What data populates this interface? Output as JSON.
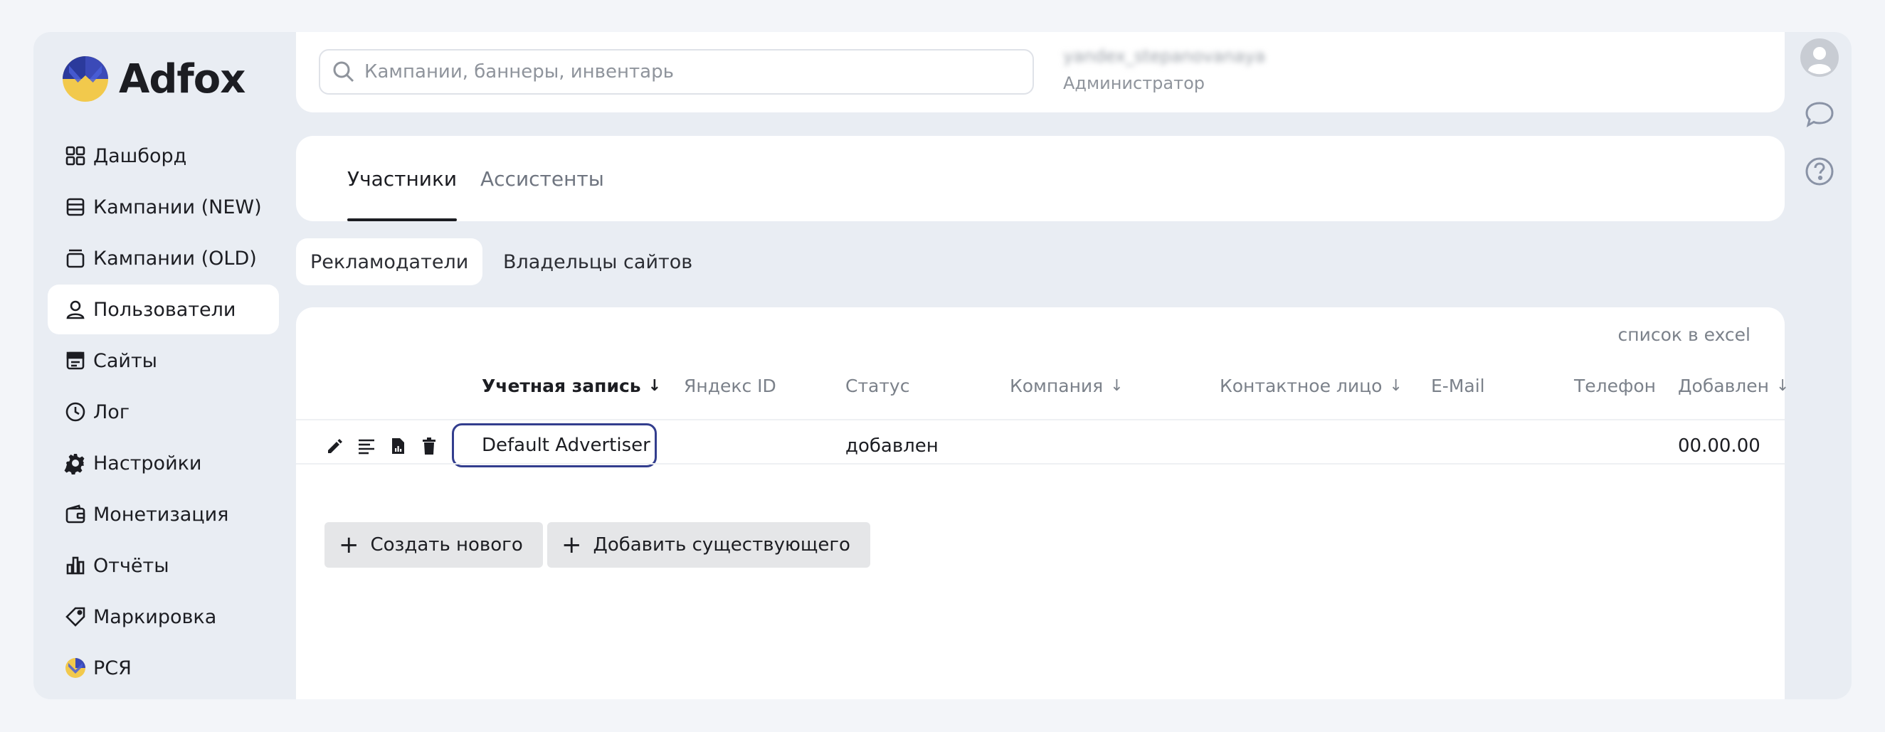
{
  "app": {
    "logo_text": "Adfox"
  },
  "sidebar": {
    "items": [
      {
        "label": "Дашборд",
        "icon": "dashboard-icon"
      },
      {
        "label": "Кампании (NEW)",
        "icon": "campaigns-new-icon"
      },
      {
        "label": "Кампании (OLD)",
        "icon": "campaigns-old-icon"
      },
      {
        "label": "Пользователи",
        "icon": "user-icon",
        "active": true
      },
      {
        "label": "Сайты",
        "icon": "sites-icon"
      },
      {
        "label": "Лог",
        "icon": "clock-icon"
      },
      {
        "label": "Настройки",
        "icon": "gear-icon"
      },
      {
        "label": "Монетизация",
        "icon": "wallet-icon"
      },
      {
        "label": "Отчёты",
        "icon": "bar-chart-icon"
      },
      {
        "label": "Маркировка",
        "icon": "tag-icon"
      },
      {
        "label": "РСЯ",
        "icon": "rsya-icon"
      }
    ]
  },
  "header": {
    "search_placeholder": "Кампании, баннеры, инвентарь",
    "user_name": "yandex_stepanovanaya",
    "user_role": "Администратор"
  },
  "tabs": [
    {
      "label": "Участники",
      "active": true
    },
    {
      "label": "Ассистенты",
      "active": false
    }
  ],
  "subtabs": [
    {
      "label": "Рекламодатели",
      "active": true
    },
    {
      "label": "Владельцы сайтов",
      "active": false
    }
  ],
  "table": {
    "excel_link": "список в excel",
    "columns": [
      "Учетная запись",
      "Яндекс ID",
      "Статус",
      "Компания",
      "Контактное лицо",
      "E-Mail",
      "Телефон",
      "Добавлен"
    ],
    "sort_arrow": "↓",
    "rows": [
      {
        "account": "Default Advertiser",
        "yandex_id": "",
        "status": "добавлен",
        "company": "",
        "contact": "",
        "email": "",
        "phone": "",
        "added": "00.00.00"
      }
    ]
  },
  "buttons": {
    "create_new": "Создать нового",
    "add_existing": "Добавить существующего",
    "plus": "+"
  },
  "colors": {
    "page_bg": "#f3f5f9",
    "frame_bg": "#e9edf3",
    "card_bg": "#ffffff",
    "selected_border": "#333e8e",
    "muted_text": "#7b818a"
  }
}
